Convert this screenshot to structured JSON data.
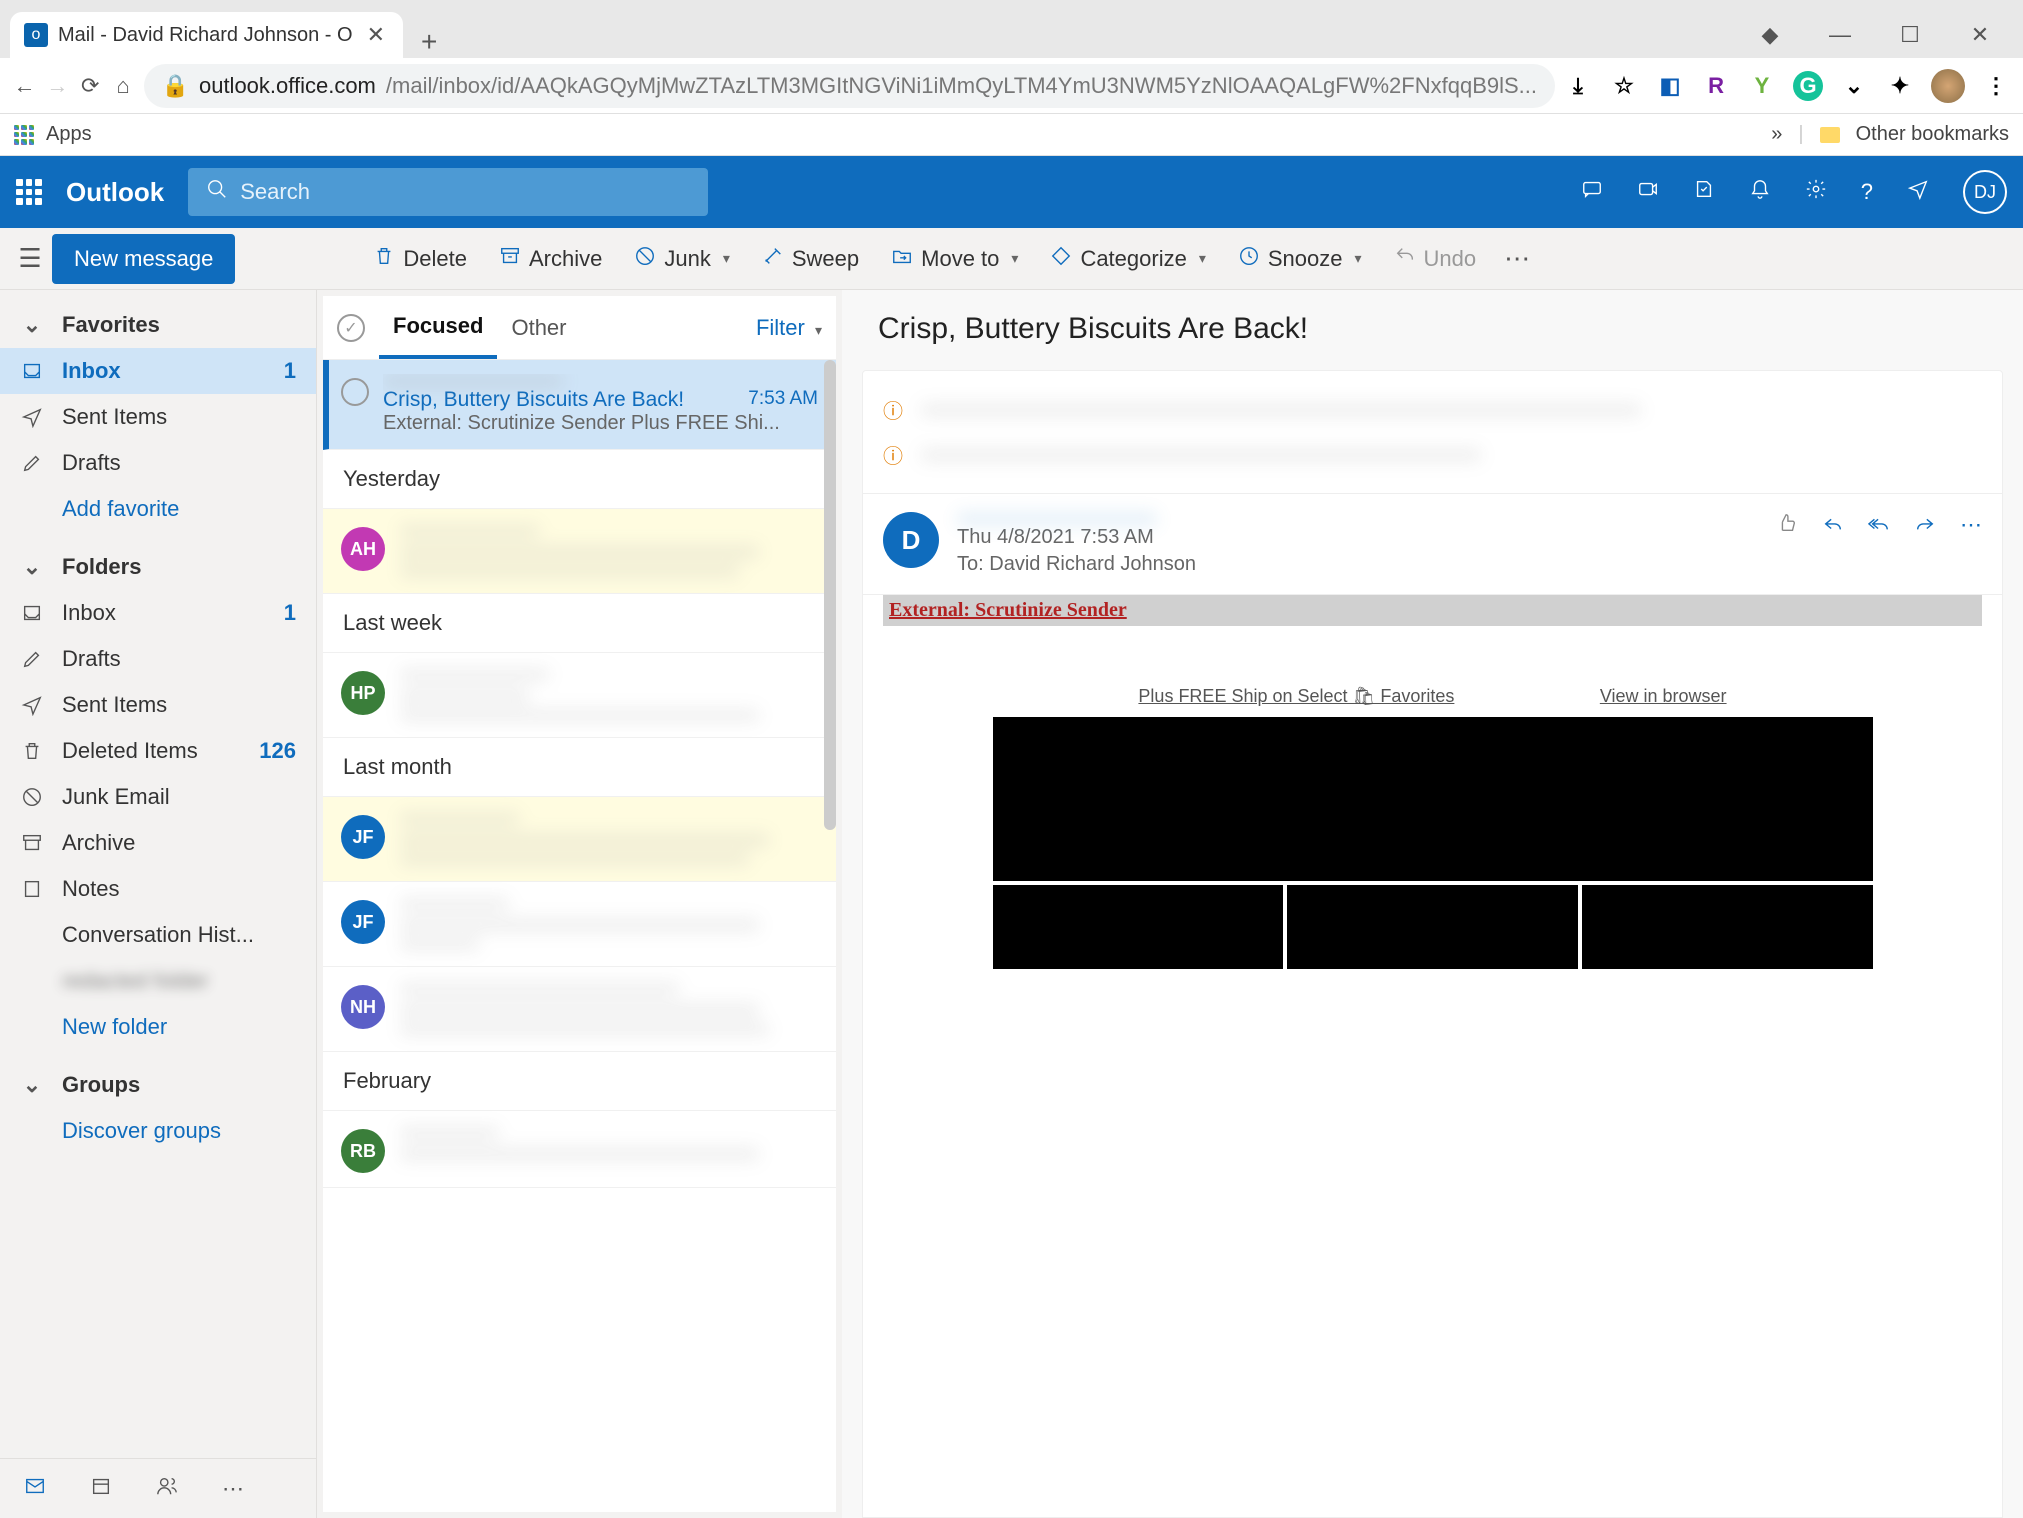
{
  "browser": {
    "tab_title": "Mail - David Richard Johnson - O",
    "url_host": "outlook.office.com",
    "url_path": "/mail/inbox/id/AAQkAGQyMjMwZTAzLTM3MGItNGViNi1iMmQyLTM4YmU3NWM5YzNlOAAQALgFW%2FNxfqqB9lS...",
    "apps_label": "Apps",
    "other_bookmarks": "Other bookmarks"
  },
  "header": {
    "brand": "Outlook",
    "search_placeholder": "Search",
    "user_initials": "DJ"
  },
  "toolbar": {
    "new_message": "New message",
    "delete": "Delete",
    "archive": "Archive",
    "junk": "Junk",
    "sweep": "Sweep",
    "move_to": "Move to",
    "categorize": "Categorize",
    "snooze": "Snooze",
    "undo": "Undo"
  },
  "folders": {
    "favorites_header": "Favorites",
    "folders_header": "Folders",
    "groups_header": "Groups",
    "inbox": "Inbox",
    "inbox_count": "1",
    "sent": "Sent Items",
    "drafts": "Drafts",
    "add_favorite": "Add favorite",
    "inbox2": "Inbox",
    "inbox2_count": "1",
    "drafts2": "Drafts",
    "sent2": "Sent Items",
    "deleted": "Deleted Items",
    "deleted_count": "126",
    "junk": "Junk Email",
    "archive": "Archive",
    "notes": "Notes",
    "conversation": "Conversation Hist...",
    "hidden_folder": "redacted folder",
    "new_folder": "New folder",
    "discover_groups": "Discover groups"
  },
  "msg_list": {
    "focused": "Focused",
    "other": "Other",
    "filter": "Filter",
    "yesterday": "Yesterday",
    "last_week": "Last week",
    "last_month": "Last month",
    "february": "February",
    "selected": {
      "subject": "Crisp, Buttery Biscuits Are Back!",
      "time": "7:53 AM",
      "preview": "External: Scrutinize Sender Plus FREE Shi..."
    },
    "avatars": [
      "AH",
      "HP",
      "JF",
      "JF",
      "NH",
      "RB"
    ]
  },
  "reading": {
    "subject": "Crisp, Buttery Biscuits Are Back!",
    "sender_initial": "D",
    "date": "Thu 4/8/2021 7:53 AM",
    "to_label": "To:",
    "to_name": "David Richard Johnson",
    "external_warning": "External: Scrutinize Sender",
    "preheader_left": "Plus FREE Ship on Select 🛍 Favorites",
    "preheader_right": "View in browser"
  }
}
